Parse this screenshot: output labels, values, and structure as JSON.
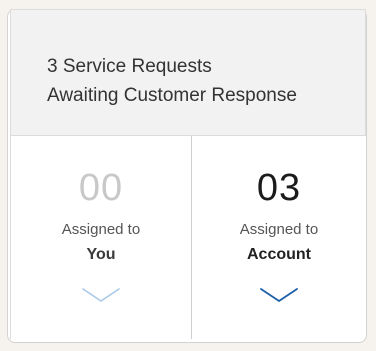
{
  "header": {
    "line1": "3 Service Requests",
    "line2": "Awaiting Customer Response"
  },
  "panels": [
    {
      "count": "00",
      "assigned_label": "Assigned to",
      "target": "You",
      "chevron_color": "#a9c8e8",
      "icon": "chevron-down-icon"
    },
    {
      "count": "03",
      "assigned_label": "Assigned to",
      "target": "Account",
      "chevron_color": "#1b5fa8",
      "icon": "chevron-down-icon"
    }
  ],
  "colors": {
    "header_bg": "#f2f2f2",
    "page_bg": "#f6f3ee",
    "muted_count": "#c8c8c8",
    "active_count": "#1b1b1b"
  }
}
